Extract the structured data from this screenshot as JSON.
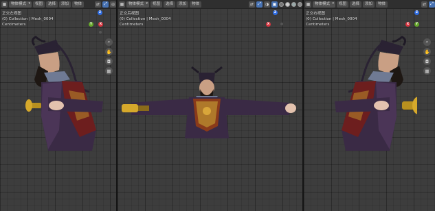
{
  "viewports": [
    {
      "id": "left",
      "mode_label": "物体模式",
      "menu": [
        "视图",
        "选择",
        "添加",
        "物体"
      ],
      "view_name": "正交左视图",
      "collection": "(0) Collection | Mesh_0004",
      "units": "Centimeters"
    },
    {
      "id": "center",
      "mode_label": "物体模式",
      "menu": [
        "视图",
        "选择",
        "添加",
        "物体"
      ],
      "view_name": "正交后视图",
      "collection": "(0) Collection | Mesh_0004",
      "units": "Centimeters"
    },
    {
      "id": "right",
      "mode_label": "物体模式",
      "menu": [
        "视图",
        "选择",
        "添加",
        "物体"
      ],
      "view_name": "正交右视图",
      "collection": "(0) Collection | Mesh_0004",
      "units": "Centimeters"
    }
  ],
  "gizmo_axes": {
    "z": "Z",
    "y": "Y",
    "x": "X"
  },
  "nav_icons": [
    "zoom-icon",
    "hand-pan-icon",
    "camera-icon",
    "grid-icon"
  ],
  "colors": {
    "viewport_bg": "#3d3d3d",
    "header_bg": "#2f2f2f",
    "axis_x": "#d8343f",
    "axis_y": "#66a82b",
    "axis_z": "#2f6ee6",
    "active_button": "#4772b3"
  }
}
